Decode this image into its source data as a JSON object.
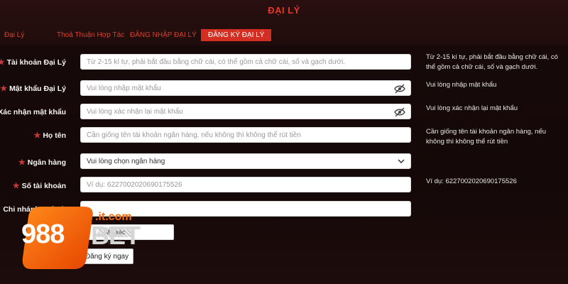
{
  "header": {
    "title": "ĐẠI LÝ"
  },
  "nav": {
    "items": [
      {
        "label": "Đại Lý"
      },
      {
        "label": "Thoả Thuận Hợp Tác"
      },
      {
        "label": "ĐĂNG NHẬP ĐẠI LÝ"
      },
      {
        "label": "ĐĂNG KÝ ĐẠI LÝ",
        "active": true
      }
    ]
  },
  "form": {
    "account": {
      "label": "Tài khoản Đại Lý",
      "placeholder": "Từ 2-15 kí tự, phải bắt đầu bằng chữ cái, có thể  gồm cả chữ cái, số và gạch dưới.",
      "hint": "Từ 2-15 kí tự, phải bắt đầu bằng chữ cái, có thể gồm cả chữ cái, số và gạch dưới."
    },
    "password": {
      "label": "Mật khẩu Đại Lý",
      "placeholder": "Vui lòng nhập mật khẩu",
      "hint": "Vui lòng nhập mật khẩu"
    },
    "confirm": {
      "label": "Xác nhận mật khẩu",
      "placeholder": "Vui lòng xác nhận lại mật khẩu",
      "hint": "Vui lòng xác nhận lại mật khẩu"
    },
    "fullname": {
      "label": "Họ tên",
      "placeholder": "Cần giống tên tài khoản ngân hàng, nếu không thì không thể rút tiền",
      "hint": "Cần giống tên tài khoản ngân hàng, nếu không thì không thể rút tiền"
    },
    "bank": {
      "label": "Ngân hàng",
      "value": "Vui lòng chọn ngân hàng"
    },
    "accountNumber": {
      "label": "Số tài khoản",
      "placeholder": "Ví dụ:  6227002020690175526",
      "hint": "Ví dụ:   6227002020690175526"
    },
    "branch": {
      "label": "Chi nhánh ngân h"
    },
    "captcha": {
      "label": "M",
      "placeholder": "Mã xác minh"
    },
    "submit": {
      "label": "Đăng ký ngay"
    }
  },
  "logo": {
    "brand_num": "988",
    "brand_word": "BET",
    "domain": ".it.com"
  },
  "colors": {
    "accent": "#d42e22",
    "title": "#e03a2c",
    "background": "#1c0d0d",
    "logo_orange": "#ff6a00"
  }
}
